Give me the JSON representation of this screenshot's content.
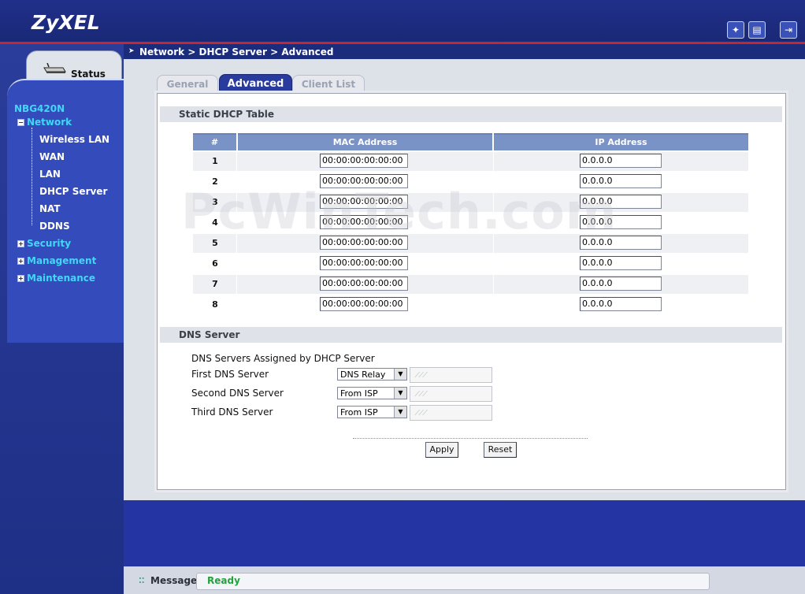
{
  "header": {
    "brand": "ZyXEL",
    "icons": [
      {
        "name": "wizard-icon",
        "glyph": "✦"
      },
      {
        "name": "help-icon",
        "glyph": "▤"
      },
      {
        "name": "logout-icon",
        "glyph": "⇥"
      }
    ]
  },
  "breadcrumb": "Network > DHCP Server > Advanced",
  "sidebar": {
    "status_label": "Status",
    "device": "NBG420N",
    "network_label": "Network",
    "network_items": [
      "Wireless LAN",
      "WAN",
      "LAN",
      "DHCP Server",
      "NAT",
      "DDNS"
    ],
    "groups": [
      "Security",
      "Management",
      "Maintenance"
    ]
  },
  "tabs": {
    "general": "General",
    "advanced": "Advanced",
    "client_list": "Client List"
  },
  "static_dhcp": {
    "section_title": "Static DHCP Table",
    "columns": [
      "#",
      "MAC Address",
      "IP Address"
    ],
    "rows": [
      {
        "num": "1",
        "mac": "00:00:00:00:00:00",
        "ip": "0.0.0.0"
      },
      {
        "num": "2",
        "mac": "00:00:00:00:00:00",
        "ip": "0.0.0.0"
      },
      {
        "num": "3",
        "mac": "00:00:00:00:00:00",
        "ip": "0.0.0.0"
      },
      {
        "num": "4",
        "mac": "00:00:00:00:00:00",
        "ip": "0.0.0.0"
      },
      {
        "num": "5",
        "mac": "00:00:00:00:00:00",
        "ip": "0.0.0.0"
      },
      {
        "num": "6",
        "mac": "00:00:00:00:00:00",
        "ip": "0.0.0.0"
      },
      {
        "num": "7",
        "mac": "00:00:00:00:00:00",
        "ip": "0.0.0.0"
      },
      {
        "num": "8",
        "mac": "00:00:00:00:00:00",
        "ip": "0.0.0.0"
      }
    ]
  },
  "dns": {
    "section_title": "DNS Server",
    "intro": "DNS Servers Assigned by DHCP Server",
    "servers": [
      {
        "label": "First DNS Server",
        "selected": "DNS Relay"
      },
      {
        "label": "Second DNS Server",
        "selected": "From ISP"
      },
      {
        "label": "Third DNS Server",
        "selected": "From ISP"
      }
    ]
  },
  "buttons": {
    "apply": "Apply",
    "reset": "Reset"
  },
  "status": {
    "label": "Message",
    "text": "Ready"
  },
  "watermark": "PcWinTech.com"
}
